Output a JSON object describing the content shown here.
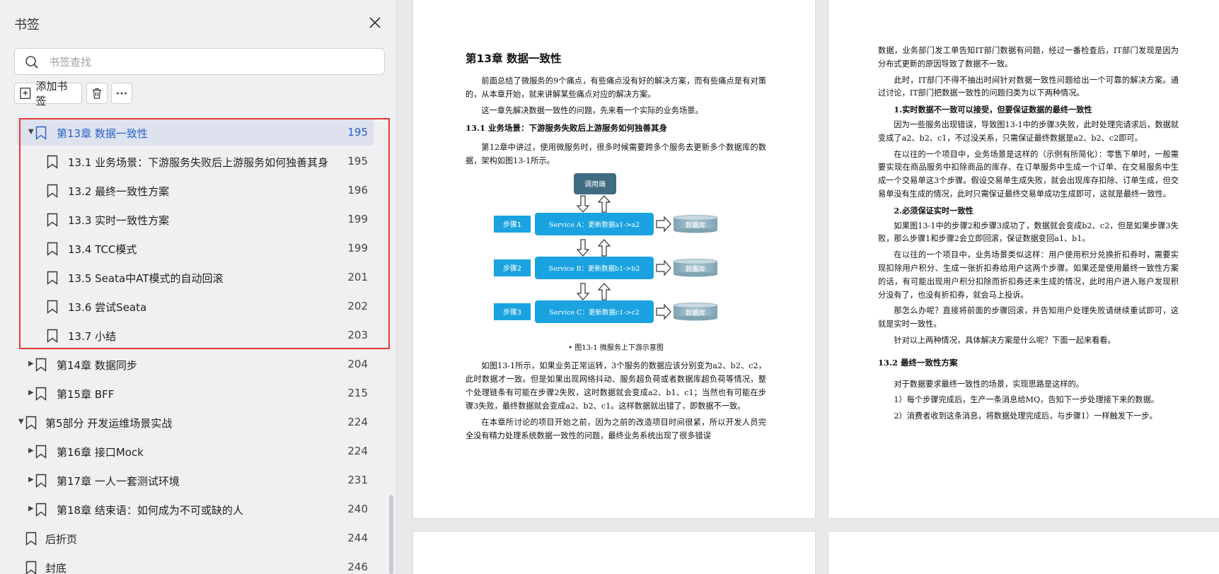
{
  "sidebar": {
    "title": "书签",
    "search_placeholder": "书签查找",
    "add_bookmark_label": "添加书签",
    "bookmarks": [
      {
        "label": "第13章 数据一致性",
        "page": "195",
        "level": 1,
        "expanded": true,
        "selected": true
      },
      {
        "label": "13.1 业务场景：下游服务失败后上游服务如何独善其身",
        "page": "195",
        "level": 2
      },
      {
        "label": "13.2 最终一致性方案",
        "page": "196",
        "level": 2
      },
      {
        "label": "13.3 实时一致性方案",
        "page": "199",
        "level": 2
      },
      {
        "label": "13.4 TCC模式",
        "page": "199",
        "level": 2
      },
      {
        "label": "13.5 Seata中AT模式的自动回滚",
        "page": "201",
        "level": 2
      },
      {
        "label": "13.6 尝试Seata",
        "page": "202",
        "level": 2
      },
      {
        "label": "13.7 小结",
        "page": "203",
        "level": 2
      },
      {
        "label": "第14章 数据同步",
        "page": "204",
        "level": 1,
        "expanded": false
      },
      {
        "label": "第15章 BFF",
        "page": "215",
        "level": 1,
        "expanded": false
      },
      {
        "label": "第5部分 开发运维场景实战",
        "page": "224",
        "level": 0,
        "expanded": true
      },
      {
        "label": "第16章 接口Mock",
        "page": "224",
        "level": 1,
        "expanded": false
      },
      {
        "label": "第17章 一人一套测试环境",
        "page": "231",
        "level": 1,
        "expanded": false
      },
      {
        "label": "第18章 结束语：如何成为不可或缺的人",
        "page": "240",
        "level": 1,
        "expanded": false
      },
      {
        "label": "后折页",
        "page": "244",
        "level": 0
      },
      {
        "label": "封底",
        "page": "246",
        "level": 0
      }
    ]
  },
  "page_left": {
    "chapter_title": "第13章  数据一致性",
    "paras_top": [
      "前面总结了微服务的9个痛点，有些痛点没有好的解决方案，而有些痛点是有对策的，从本章开始，就来讲解某些痛点对应的解决方案。",
      "这一章先解决数据一致性的问题，先来看一个实际的业务场景。"
    ],
    "section_title": "13.1  业务场景：下游服务失败后上游服务如何独善其身",
    "para_mid": "第12章中讲过，使用微服务时，很多时候需要跨多个服务去更新多个数据库的数据，架构如图13-1所示。",
    "diagram": {
      "caller": "调用端",
      "steps": [
        "步骤1",
        "步骤2",
        "步骤3"
      ],
      "services": [
        "Service A：更新数据a1->a2",
        "Service B：更新数据b1->b2",
        "Service C：更新数据c1->c2"
      ],
      "db": "数据库",
      "caption": "• 图13-1  微服务上下游示意图"
    },
    "paras_bottom": [
      "如图13-1所示，如果业务正常运转，3个服务的数据应该分别变为a2、b2、c2，此时数据才一致。但是如果出现网络抖动、服务超负荷或者数据库超负荷等情况，整个处理链条有可能在步骤2失败，这时数据就会变成a2、b1、c1；当然也有可能在步骤3失败，最终数据就会变成a2、b2、c1。这样数据就出错了，即数据不一致。",
      "在本章所讨论的项目开始之前，因为之前的改造项目时间很紧，所以开发人员完全没有精力处理系统数据一致性的问题，最终业务系统出现了很多错误"
    ]
  },
  "page_right": {
    "p1": "数据，业务部门发工单告知IT部门数据有问题，经过一番检查后，IT部门发现是因为分布式更新的原因导致了数据不一致。",
    "p2": "此时，IT部门不得不抽出时间针对数据一致性问题给出一个可靠的解决方案。通过讨论，IT部门把数据一致性的问题归类为以下两种情况。",
    "h1": "1.实时数据不一致可以接受，但要保证数据的最终一致性",
    "p3": "因为一些服务出现错误，导致图13-1中的步骤3失败，此时处理完请求后，数据就变成了a2、b2、c1，不过没关系，只需保证最终数据是a2、b2、c2即可。",
    "p4": "在以往的一个项目中，业务场景是这样的（示例有所简化）：零售下单时，一般需要实现在商品服务中扣除商品的库存、在订单服务中生成一个订单、在交易服务中生成一个交易单这3个步骤。假设交易单生成失败，就会出现库存扣除、订单生成，但交易单没有生成的情况，此时只需保证最终交易单成功生成即可，这就是最终一致性。",
    "h2": "2.必须保证实时一致性",
    "p5": "如果图13-1中的步骤2和步骤3成功了，数据就会变成b2、c2，但是如果步骤3失败，那么步骤1和步骤2会立即回滚，保证数据变回a1、b1。",
    "p6": "在以往的一个项目中，业务场景类似这样：用户使用积分兑换折扣券时，需要实现扣除用户积分、生成一张折扣券给用户这两个步骤。如果还是使用最终一致性方案的话，有可能出现用户积分扣除而折扣券还未生成的情况，此时用户进入账户发现积分没有了，也没有折扣券，就会马上投诉。",
    "p7": "那怎么办呢？直接将前面的步骤回滚，并告知用户处理失败请继续重试即可，这就是实时一致性。",
    "p8": "针对以上两种情况，具体解决方案是什么呢？下面一起来看看。",
    "section": "13.2  最终一致性方案",
    "p9": "对于数据要求最终一致性的场景，实现思路是这样的。",
    "p10": "1）每个步骤完成后，生产一条消息给MQ，告知下一步处理接下来的数据。",
    "p11": "2）消费者收到这条消息，将数据处理完成后，与步骤1）一样触发下一步。"
  },
  "colors": {
    "selected_text": "#2a62c9",
    "selected_bg": "#dde2ee",
    "highlight_border": "#e53935",
    "diagram_box": "#1aa3e0",
    "diagram_caller": "#3f6c80",
    "diagram_db": "#8fb1bf"
  }
}
